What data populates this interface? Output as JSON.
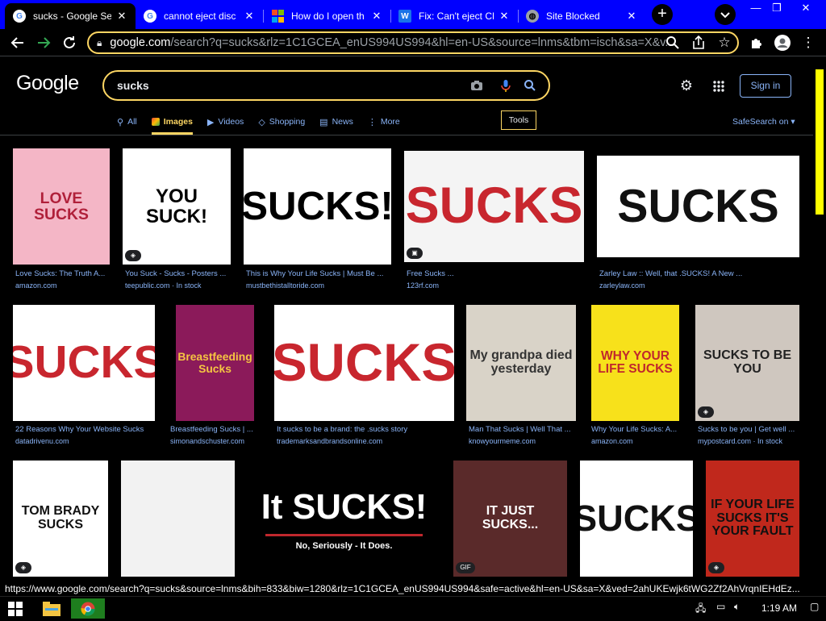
{
  "tabs": [
    {
      "title": "sucks - Google Se",
      "favicon": "G",
      "active": true
    },
    {
      "title": "cannot eject disc",
      "favicon": "G",
      "active": false
    },
    {
      "title": "How do I open th",
      "favicon": "microsoft",
      "active": false
    },
    {
      "title": "Fix: Can't eject CD",
      "favicon": "W",
      "active": false
    },
    {
      "title": "Site Blocked",
      "favicon": "globe",
      "active": false
    }
  ],
  "omnibox": {
    "host": "google.com",
    "path": "/search?q=sucks&rlz=1C1GCEA_enUS994US994&hl=en-US&source=lnms&tbm=isch&sa=X&v..."
  },
  "google": {
    "logo": "Google",
    "query": "sucks",
    "signin": "Sign in",
    "nav": [
      {
        "label": "All",
        "icon": "search-icon"
      },
      {
        "label": "Images",
        "icon": "image-icon",
        "active": true
      },
      {
        "label": "Videos",
        "icon": "video-icon"
      },
      {
        "label": "Shopping",
        "icon": "tag-icon"
      },
      {
        "label": "News",
        "icon": "news-icon"
      },
      {
        "label": "More",
        "icon": "more-vert-icon"
      }
    ],
    "tools": "Tools",
    "safesearch": "SafeSearch on"
  },
  "results": [
    {
      "caption": "Love Sucks: The Truth A...",
      "source": "amazon.com",
      "thumb_text": "LOVE SUCKS",
      "thumb_bg": "#f4b6c6",
      "thumb_fg": "#b0203a"
    },
    {
      "caption": "You Suck - Sucks - Posters ...",
      "source": "teepublic.com · In stock",
      "thumb_text": "YOU SUCK!",
      "thumb_bg": "#ffffff",
      "thumb_fg": "#000000",
      "badge": "tag"
    },
    {
      "caption": "This is Why Your Life Sucks | Must Be ...",
      "source": "mustbethistalltoride.com",
      "thumb_text": "SUCKS!",
      "thumb_bg": "#ffffff",
      "thumb_fg": "#000000"
    },
    {
      "caption": "Free Sucks ...",
      "source": "123rf.com",
      "thumb_text": "SUCKS",
      "thumb_bg": "#f4f4f4",
      "thumb_fg": "#c8262e",
      "badge": "image"
    },
    {
      "caption": "Zarley Law :: Well, that .SUCKS! A New ...",
      "source": "zarleylaw.com",
      "thumb_text": "SUCKS",
      "thumb_bg": "#ffffff",
      "thumb_fg": "#111111"
    },
    {
      "caption": "22 Reasons Why Your Website Sucks",
      "source": "datadrivenu.com",
      "thumb_text": "SUCKS",
      "thumb_bg": "#ffffff",
      "thumb_fg": "#c8262e"
    },
    {
      "caption": "Breastfeeding Sucks | ...",
      "source": "simonandschuster.com",
      "thumb_text": "Breastfeeding Sucks",
      "thumb_bg": "#8b1a5a",
      "thumb_fg": "#f5c542"
    },
    {
      "caption": "It sucks to be a brand: the .sucks story",
      "source": "trademarksandbrandsonline.com",
      "thumb_text": "SUCKS",
      "thumb_bg": "#ffffff",
      "thumb_fg": "#c8262e"
    },
    {
      "caption": "Man That Sucks | Well That ...",
      "source": "knowyourmeme.com",
      "thumb_text": "My grandpa died yesterday",
      "thumb_bg": "#d9d3c8",
      "thumb_fg": "#333333"
    },
    {
      "caption": "Why Your Life Sucks: A...",
      "source": "amazon.com",
      "thumb_text": "WHY YOUR LIFE SUCKS",
      "thumb_bg": "#f7e11b",
      "thumb_fg": "#c0272d"
    },
    {
      "caption": "Sucks to be you | Get well ...",
      "source": "mypostcard.com · In stock",
      "thumb_text": "SUCKS TO BE YOU",
      "thumb_bg": "#cfc7bf",
      "thumb_fg": "#222222",
      "badge": "tag"
    },
    {
      "caption": "",
      "source": "",
      "thumb_text": "TOM BRADY SUCKS",
      "thumb_bg": "#ffffff",
      "thumb_fg": "#111111",
      "badge": "tag"
    },
    {
      "caption": "",
      "source": "",
      "thumb_text": "",
      "thumb_bg": "#f2f2f2",
      "thumb_fg": "#444444"
    },
    {
      "caption": "",
      "source": "",
      "thumb_text": "It SUCKS!",
      "thumb_sub": "No, Seriously - It Does.",
      "thumb_bg": "#000000",
      "thumb_fg": "#ffffff"
    },
    {
      "caption": "",
      "source": "",
      "thumb_text": "IT JUST SUCKS...",
      "thumb_bg": "#5a2a2a",
      "thumb_fg": "#ffffff",
      "badge": "GIF"
    },
    {
      "caption": "",
      "source": "",
      "thumb_text": "SUCKS",
      "thumb_bg": "#ffffff",
      "thumb_fg": "#111111"
    },
    {
      "caption": "",
      "source": "",
      "thumb_text": "IF YOUR LIFE SUCKS IT'S YOUR FAULT",
      "thumb_bg": "#c0281c",
      "thumb_fg": "#111111",
      "badge": "tag"
    }
  ],
  "statusbar": "https://www.google.com/search?q=sucks&source=lnms&bih=833&biw=1280&rlz=1C1GCEA_enUS994US994&safe=active&hl=en-US&sa=X&ved=2ahUKEwjk6tWG2Zf2AhVrqnIEHdEz...",
  "taskbar": {
    "time": "1:19 AM"
  },
  "colors": {
    "accent": "#fdd663",
    "link": "#8ab4f8",
    "tabstrip": "#0000ff",
    "scrollthumb": "#ffff00"
  }
}
